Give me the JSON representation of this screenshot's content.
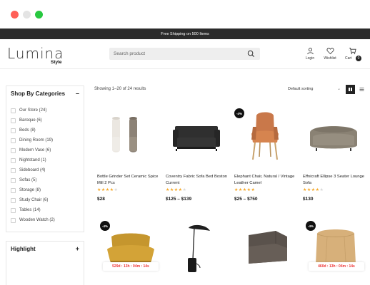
{
  "window_controls": [
    "close",
    "minimize",
    "maximize"
  ],
  "announcement": "Free Shipping on 500 Items",
  "brand": {
    "name": "Lumina",
    "sub": "Style"
  },
  "search": {
    "placeholder": "Search product",
    "icon": "search-icon"
  },
  "header_actions": [
    {
      "label": "Login",
      "icon": "user-icon"
    },
    {
      "label": "Wishlist",
      "icon": "heart-icon"
    },
    {
      "label": "Cart",
      "icon": "cart-icon",
      "count": "0"
    }
  ],
  "sidebar": {
    "categories_title": "Shop By Categories",
    "categories_toggle": "–",
    "categories": [
      "Our Store (24)",
      "Baroque (6)",
      "Beds (8)",
      "Dining Room (19)",
      "Modern Vase (6)",
      "Nightstand (1)",
      "Sideboard (4)",
      "Sofas (5)",
      "Storage (8)",
      "Study Chair (6)",
      "Tables (14)",
      "Wooden Watch (2)"
    ],
    "highlight_title": "Highlight",
    "highlight_toggle": "+"
  },
  "toolbar": {
    "result_count": "Showing 1–20 of 24 results",
    "sort_value": "Default sorting",
    "grid_icon": "grid-view-icon",
    "list_icon": "list-view-icon"
  },
  "products": [
    {
      "name": "Bottle Grinder Set Ceramic Spice Mill 2 Pcs",
      "price": "$28",
      "rating": 4,
      "badge": "",
      "countdown": ""
    },
    {
      "name": "Coventry Fabric Sofa Bed Boston Current",
      "price": "$125 – $139",
      "rating": 4,
      "badge": "",
      "countdown": ""
    },
    {
      "name": "Elephant Chair, Natural / Vintage Leather Camel",
      "price": "$25 – $750",
      "rating": 5,
      "badge": "-4%",
      "countdown": ""
    },
    {
      "name": "Effnicraft Ellipse 3 Seater Lounge Sofa",
      "price": "$130",
      "rating": 4,
      "badge": "",
      "countdown": ""
    },
    {
      "name": "",
      "price": "",
      "rating": 0,
      "badge": "-4%",
      "countdown": "529d : 13h : 04m : 14s"
    },
    {
      "name": "",
      "price": "",
      "rating": 0,
      "badge": "",
      "countdown": ""
    },
    {
      "name": "",
      "price": "",
      "rating": 0,
      "badge": "",
      "countdown": ""
    },
    {
      "name": "",
      "price": "",
      "rating": 0,
      "badge": "-4%",
      "countdown": "460d : 13h : 04m : 14s"
    }
  ],
  "colors": {
    "accent": "#f5a623",
    "dark": "#2b2b2b",
    "sale": "#e33333"
  }
}
